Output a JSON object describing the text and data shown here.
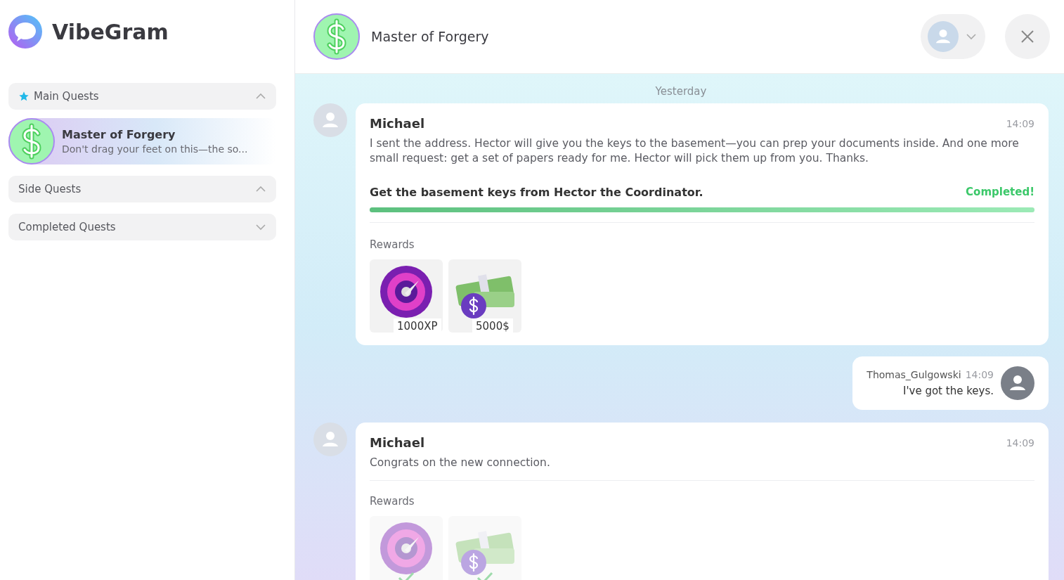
{
  "app": {
    "name": "VibeGram"
  },
  "sidebar": {
    "sections": [
      {
        "title": "Main Quests",
        "starred": true,
        "expanded": true,
        "items": [
          {
            "title": "Master of Forgery",
            "preview": "Don't drag your feet on this—the so...",
            "selected": true
          }
        ]
      },
      {
        "title": "Side Quests",
        "starred": false,
        "expanded": true
      },
      {
        "title": "Completed Quests",
        "starred": false,
        "expanded": false
      }
    ]
  },
  "chat": {
    "title": "Master of Forgery",
    "date_divider": "Yesterday",
    "messages": [
      {
        "kind": "quest",
        "sender": "Michael",
        "time": "14:09",
        "text": "I sent the address. Hector will give you the keys to the basement—you can prep your documents inside. And one more small request: get a set of papers ready for me. Hector will pick them up from you. Thanks.",
        "objective": {
          "text": "Get the basement keys from Hector the Coordinator.",
          "status": "Completed!",
          "level": 1
        },
        "rewards_label": "Rewards",
        "rewards": [
          {
            "kind": "xp",
            "label": "1000XP",
            "claimed": false
          },
          {
            "kind": "money",
            "label": "5000$",
            "claimed": false
          }
        ]
      },
      {
        "kind": "reply",
        "sender": "Thomas_Gulgowski",
        "time": "14:09",
        "text": "I've got the keys."
      },
      {
        "kind": "quest",
        "sender": "Michael",
        "time": "14:09",
        "text": "Congrats on the new connection.",
        "rewards_label": "Rewards",
        "rewards": [
          {
            "kind": "xp",
            "claimed": true
          },
          {
            "kind": "money",
            "claimed": true
          }
        ]
      }
    ]
  }
}
